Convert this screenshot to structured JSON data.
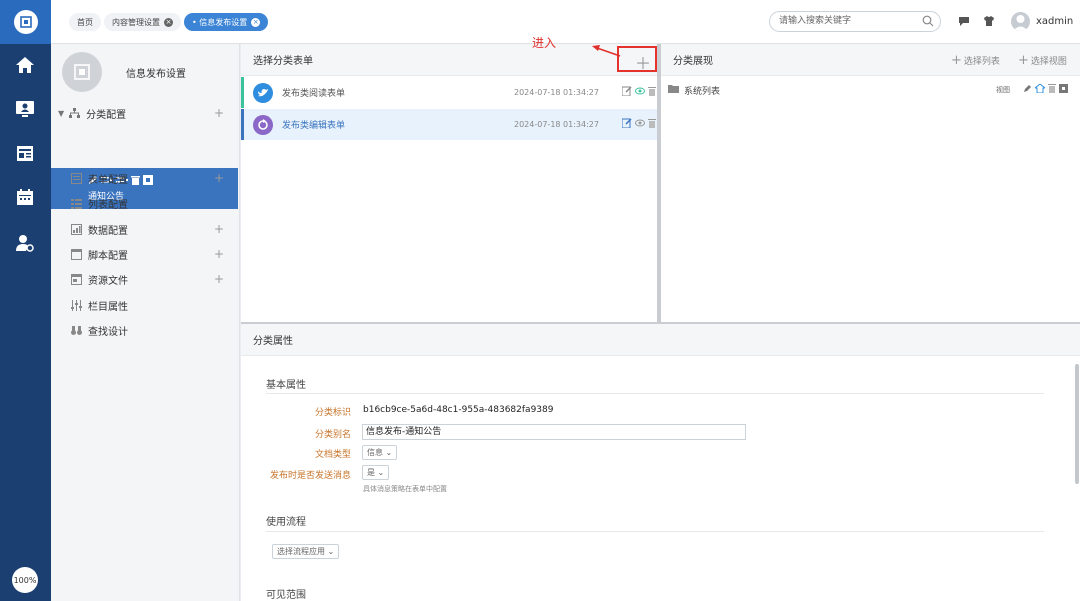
{
  "rail": {
    "zoom_label": "100%"
  },
  "topbar": {
    "tabs": [
      {
        "label": "首页"
      },
      {
        "label": "内容管理设置"
      },
      {
        "label": "• 信息发布设置"
      }
    ],
    "search_placeholder": "请输入搜索关键字",
    "username": "xadmin"
  },
  "sidebar": {
    "title": "信息发布设置",
    "items": [
      {
        "label": "分类配置"
      },
      {
        "label": "表单配置"
      },
      {
        "label": "列表配置"
      },
      {
        "label": "数据配置"
      },
      {
        "label": "脚本配置"
      },
      {
        "label": "资源文件"
      },
      {
        "label": "栏目属性"
      },
      {
        "label": "查找设计"
      }
    ],
    "selected_child": "通知公告"
  },
  "form_panel": {
    "title": "选择分类表单",
    "rows": [
      {
        "name": "发布类阅读表单",
        "date": "2024-07-18 01:34:27"
      },
      {
        "name": "发布类编辑表单",
        "date": "2024-07-18 01:34:27"
      }
    ]
  },
  "annotation": {
    "text": "进入"
  },
  "view_panel": {
    "title": "分类展现",
    "select_list": "选择列表",
    "select_view": "选择视图",
    "rows": [
      {
        "name": "系统列表",
        "tag": "视图"
      }
    ]
  },
  "attributes": {
    "title": "分类属性",
    "basic_section": "基本属性",
    "fields": {
      "id_label": "分类标识",
      "id_value": "b16cb9ce-5a6d-48c1-955a-483682fa9389",
      "alias_label": "分类别名",
      "alias_value": "信息发布-通知公告",
      "doctype_label": "文档类型",
      "doctype_value": "信息",
      "notify_label": "发布时是否发送消息",
      "notify_value": "是",
      "notify_note": "具体消息策略在表单中配置"
    },
    "flow_section": "使用流程",
    "flow_select": "选择流程应用",
    "visible_section": "可见范围"
  },
  "colors": {
    "rail": "#1c3f72",
    "accent": "#3b84d6",
    "selected": "#3a74bf",
    "annotation": "#e0302c"
  }
}
